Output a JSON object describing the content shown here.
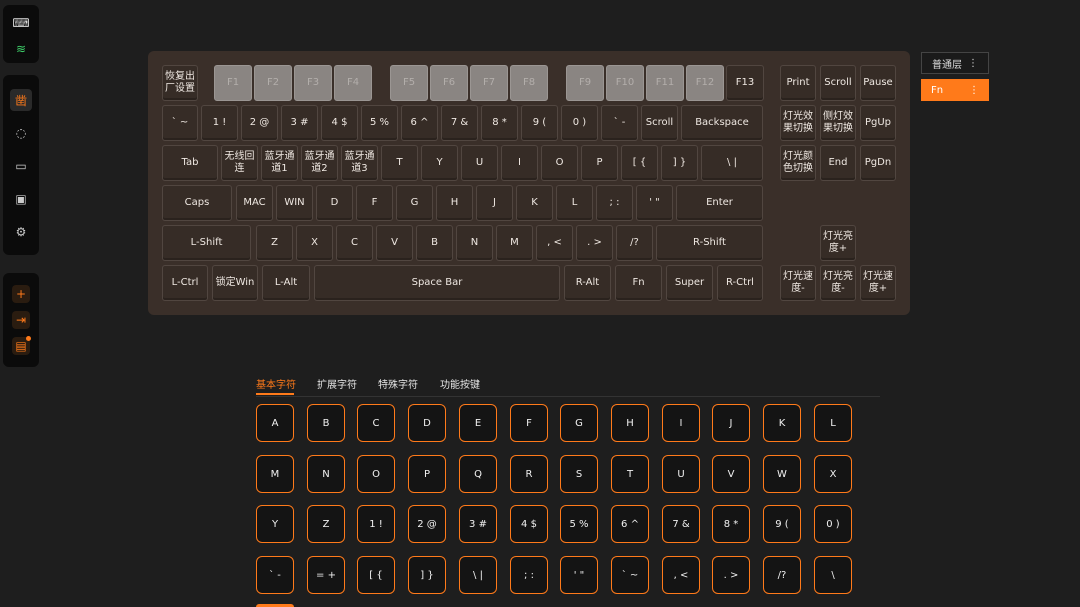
{
  "colors": {
    "accent": "#ff7a1a",
    "background": "#1e1e1e",
    "board": "#3a2f29"
  },
  "sidebar": {
    "top": [
      {
        "name": "keyboard-icon",
        "glyph": "⌨"
      },
      {
        "name": "wifi-icon",
        "glyph": "≋"
      }
    ],
    "middle": [
      {
        "name": "keymap-icon",
        "glyph": "凿"
      },
      {
        "name": "lightbulb-icon",
        "glyph": "◌"
      },
      {
        "name": "macro-icon",
        "glyph": "▭"
      },
      {
        "name": "record-icon",
        "glyph": "▣"
      },
      {
        "name": "settings-icon",
        "glyph": "⚙"
      }
    ],
    "bottom": [
      {
        "name": "add-icon",
        "glyph": "+"
      },
      {
        "name": "export-icon",
        "glyph": "⇥"
      },
      {
        "name": "document-icon",
        "glyph": "▤"
      }
    ]
  },
  "keyboard": {
    "main_rows": [
      [
        "恢复出厂设置",
        "F1",
        "F2",
        "F3",
        "F4",
        "F5",
        "F6",
        "F7",
        "F8",
        "F9",
        "F10",
        "F11",
        "F12",
        "F13"
      ],
      [
        "` ~",
        "1 !",
        "2 @",
        "3 #",
        "4 $",
        "5 %",
        "6 ^",
        "7 &",
        "8 *",
        "9 (",
        "0 )",
        "` -",
        "Scroll",
        "Backspace"
      ],
      [
        "Tab",
        "无线回连",
        "蓝牙通道1",
        "蓝牙通道2",
        "蓝牙通道3",
        "T",
        "Y",
        "U",
        "I",
        "O",
        "P",
        "[ {",
        "] }",
        "\\ |"
      ],
      [
        "Caps",
        "MAC",
        "WIN",
        "D",
        "F",
        "G",
        "H",
        "J",
        "K",
        "L",
        "; :",
        "' \"",
        "Enter"
      ],
      [
        "L-Shift",
        "Z",
        "X",
        "C",
        "V",
        "B",
        "N",
        "M",
        ", <",
        ". >",
        "/?",
        "R-Shift"
      ],
      [
        "L-Ctrl",
        "锁定Win",
        "L-Alt",
        "Space Bar",
        "R-Alt",
        "Fn",
        "Super",
        "R-Ctrl"
      ]
    ],
    "nav": [
      [
        "Print",
        "Scroll",
        "Pause"
      ],
      [
        "灯光效果切换",
        "侧灯效果切换",
        "PgUp"
      ],
      [
        "灯光颜色切换",
        "End",
        "PgDn"
      ],
      [
        "灯光亮度+"
      ],
      [
        "灯光速度-",
        "灯光亮度-",
        "灯光速度+"
      ]
    ]
  },
  "layers": {
    "normal_label": "普通层",
    "fn_label": "Fn",
    "menu_glyph": "⋮"
  },
  "tabs": [
    "基本字符",
    "扩展字符",
    "特殊字符",
    "功能按键"
  ],
  "char_rows": [
    [
      "A",
      "B",
      "C",
      "D",
      "E",
      "F",
      "G",
      "H",
      "I",
      "J",
      "K",
      "L"
    ],
    [
      "M",
      "N",
      "O",
      "P",
      "Q",
      "R",
      "S",
      "T",
      "U",
      "V",
      "W",
      "X"
    ],
    [
      "Y",
      "Z",
      "1 !",
      "2 @",
      "3 #",
      "4 $",
      "5 %",
      "6 ^",
      "7 &",
      "8 *",
      "9 (",
      "0 )"
    ],
    [
      "` -",
      "= +",
      "[ {",
      "] }",
      "\\ |",
      "; :",
      "' \"",
      "` ~",
      ", <",
      ". >",
      "/?",
      "\\"
    ]
  ]
}
